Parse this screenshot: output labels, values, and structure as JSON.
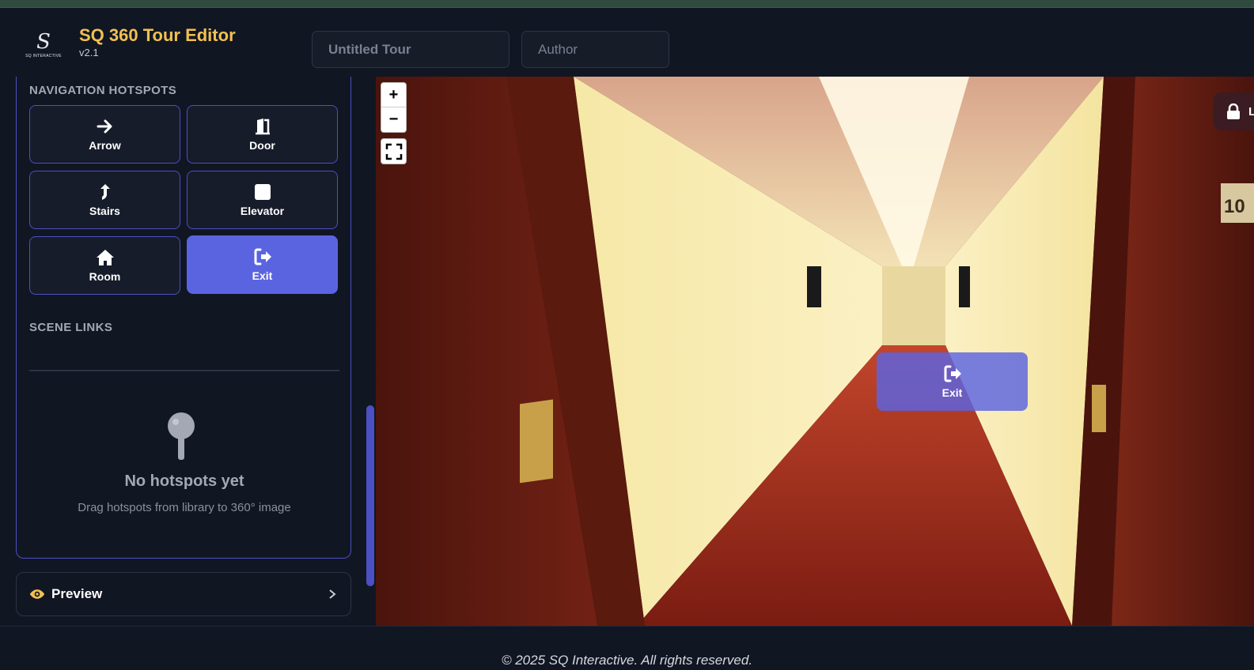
{
  "app": {
    "logo_text": "SQ INTERACTIVE",
    "title": "SQ 360 Tour Editor",
    "version": "v2.1"
  },
  "header": {
    "tour_title_placeholder": "Untitled Tour",
    "author_placeholder": "Author"
  },
  "sidebar": {
    "nav_hotspots_label": "NAVIGATION HOTSPOTS",
    "hotspots": [
      {
        "label": "Arrow",
        "icon": "arrow-right-icon"
      },
      {
        "label": "Door",
        "icon": "door-icon"
      },
      {
        "label": "Stairs",
        "icon": "stairs-icon"
      },
      {
        "label": "Elevator",
        "icon": "elevator-icon"
      },
      {
        "label": "Room",
        "icon": "home-icon"
      },
      {
        "label": "Exit",
        "icon": "exit-icon",
        "active": true
      }
    ],
    "scene_links_label": "SCENE LINKS",
    "empty_title": "No hotspots yet",
    "empty_subtitle": "Drag hotspots from library to 360° image"
  },
  "preview": {
    "label": "Preview"
  },
  "viewer": {
    "zoom_in": "+",
    "zoom_out": "−",
    "lock_label": "L",
    "placed_hotspot_label": "Exit",
    "room_number": "10"
  },
  "footer": {
    "copyright": "© 2025 SQ Interactive. All rights reserved."
  },
  "colors": {
    "accent": "#5b64e0",
    "brand": "#f1c051",
    "background": "#111623"
  }
}
